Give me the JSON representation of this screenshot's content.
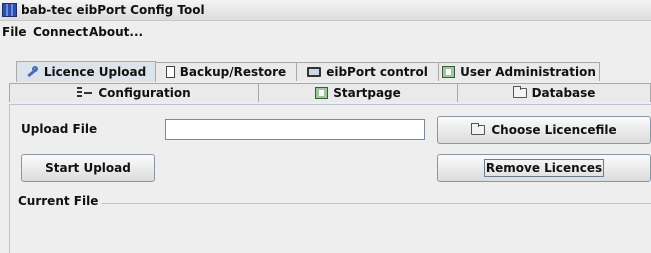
{
  "window": {
    "title": "bab-tec eibPort Config Tool"
  },
  "menu": [
    "File",
    "Connect",
    "About..."
  ],
  "tabs_row1": [
    {
      "label": "Licence Upload",
      "icon": "key-icon",
      "active": true
    },
    {
      "label": "Backup/Restore",
      "icon": "document-icon"
    },
    {
      "label": "eibPort control",
      "icon": "monitor-icon"
    },
    {
      "label": "User Administration",
      "icon": "user-admin-icon"
    }
  ],
  "tabs_row2": [
    {
      "label": "Configuration",
      "icon": "configuration-icon"
    },
    {
      "label": "Startpage",
      "icon": "startpage-icon"
    },
    {
      "label": "Database",
      "icon": "folder-icon"
    }
  ],
  "form": {
    "upload_file_label": "Upload File",
    "upload_file_value": "",
    "choose_button": "Choose Licencefile",
    "start_button": "Start Upload",
    "remove_button": "Remove Licences",
    "current_file_label": "Current File"
  }
}
